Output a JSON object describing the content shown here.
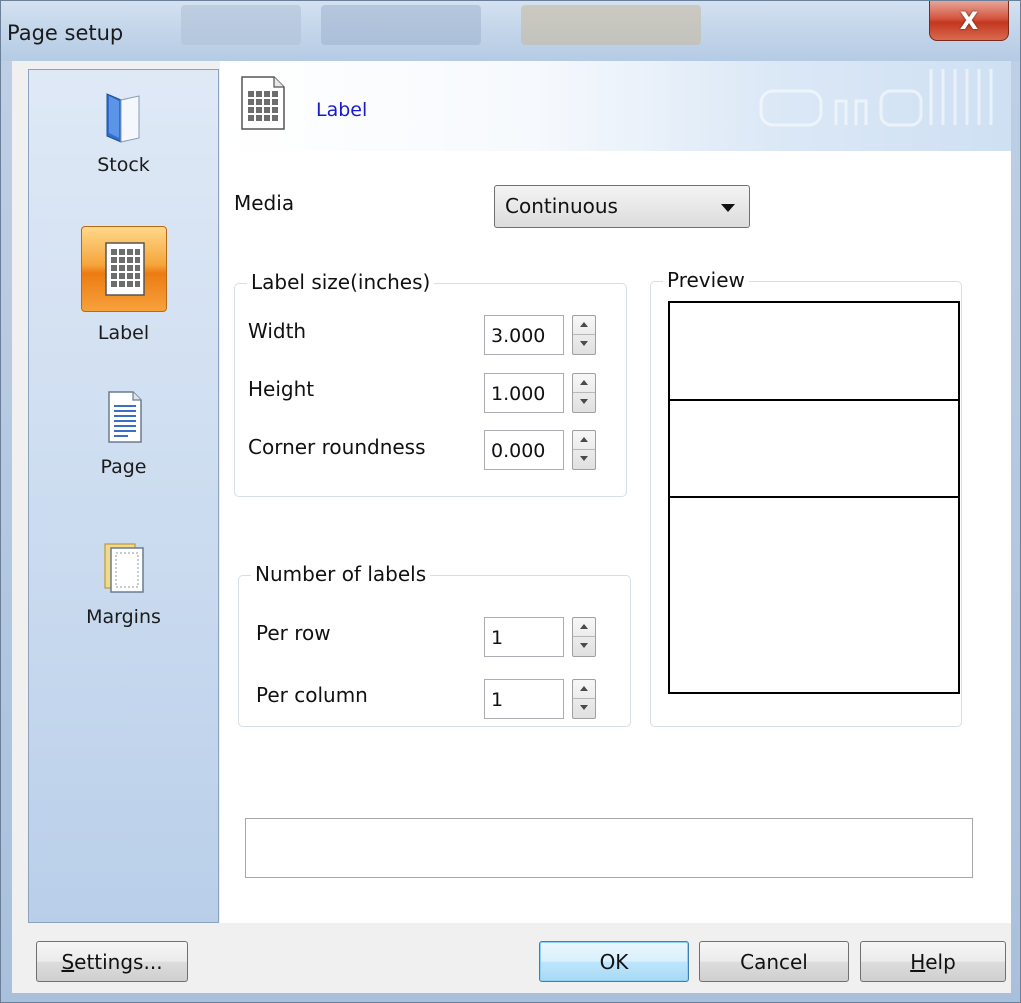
{
  "window": {
    "title": "Page setup",
    "close_label": "X"
  },
  "sidebar": {
    "items": [
      {
        "label": "Stock",
        "icon": "stock-folder-icon",
        "selected": false
      },
      {
        "label": "Label",
        "icon": "label-grid-icon",
        "selected": true
      },
      {
        "label": "Page",
        "icon": "page-document-icon",
        "selected": false
      },
      {
        "label": "Margins",
        "icon": "margins-page-icon",
        "selected": false
      }
    ]
  },
  "header": {
    "title": "Label",
    "icon": "label-grid-icon"
  },
  "media": {
    "label": "Media",
    "selected": "Continuous"
  },
  "label_size": {
    "title": "Label size(inches)",
    "fields": [
      {
        "label": "Width",
        "value": "3.000"
      },
      {
        "label": "Height",
        "value": "1.000"
      },
      {
        "label": "Corner roundness",
        "value": "0.000"
      }
    ]
  },
  "number_of_labels": {
    "title": "Number of labels",
    "fields": [
      {
        "label": "Per row",
        "value": "1"
      },
      {
        "label": "Per column",
        "value": "1"
      }
    ]
  },
  "preview": {
    "title": "Preview"
  },
  "buttons": {
    "settings_first": "S",
    "settings_rest": "ettings...",
    "ok": "OK",
    "cancel": "Cancel",
    "help_first": "H",
    "help_rest": "elp"
  },
  "colors": {
    "accent_selected": "#f39b2e",
    "header_title": "#1a1ac8",
    "close_button": "#c9452b"
  }
}
